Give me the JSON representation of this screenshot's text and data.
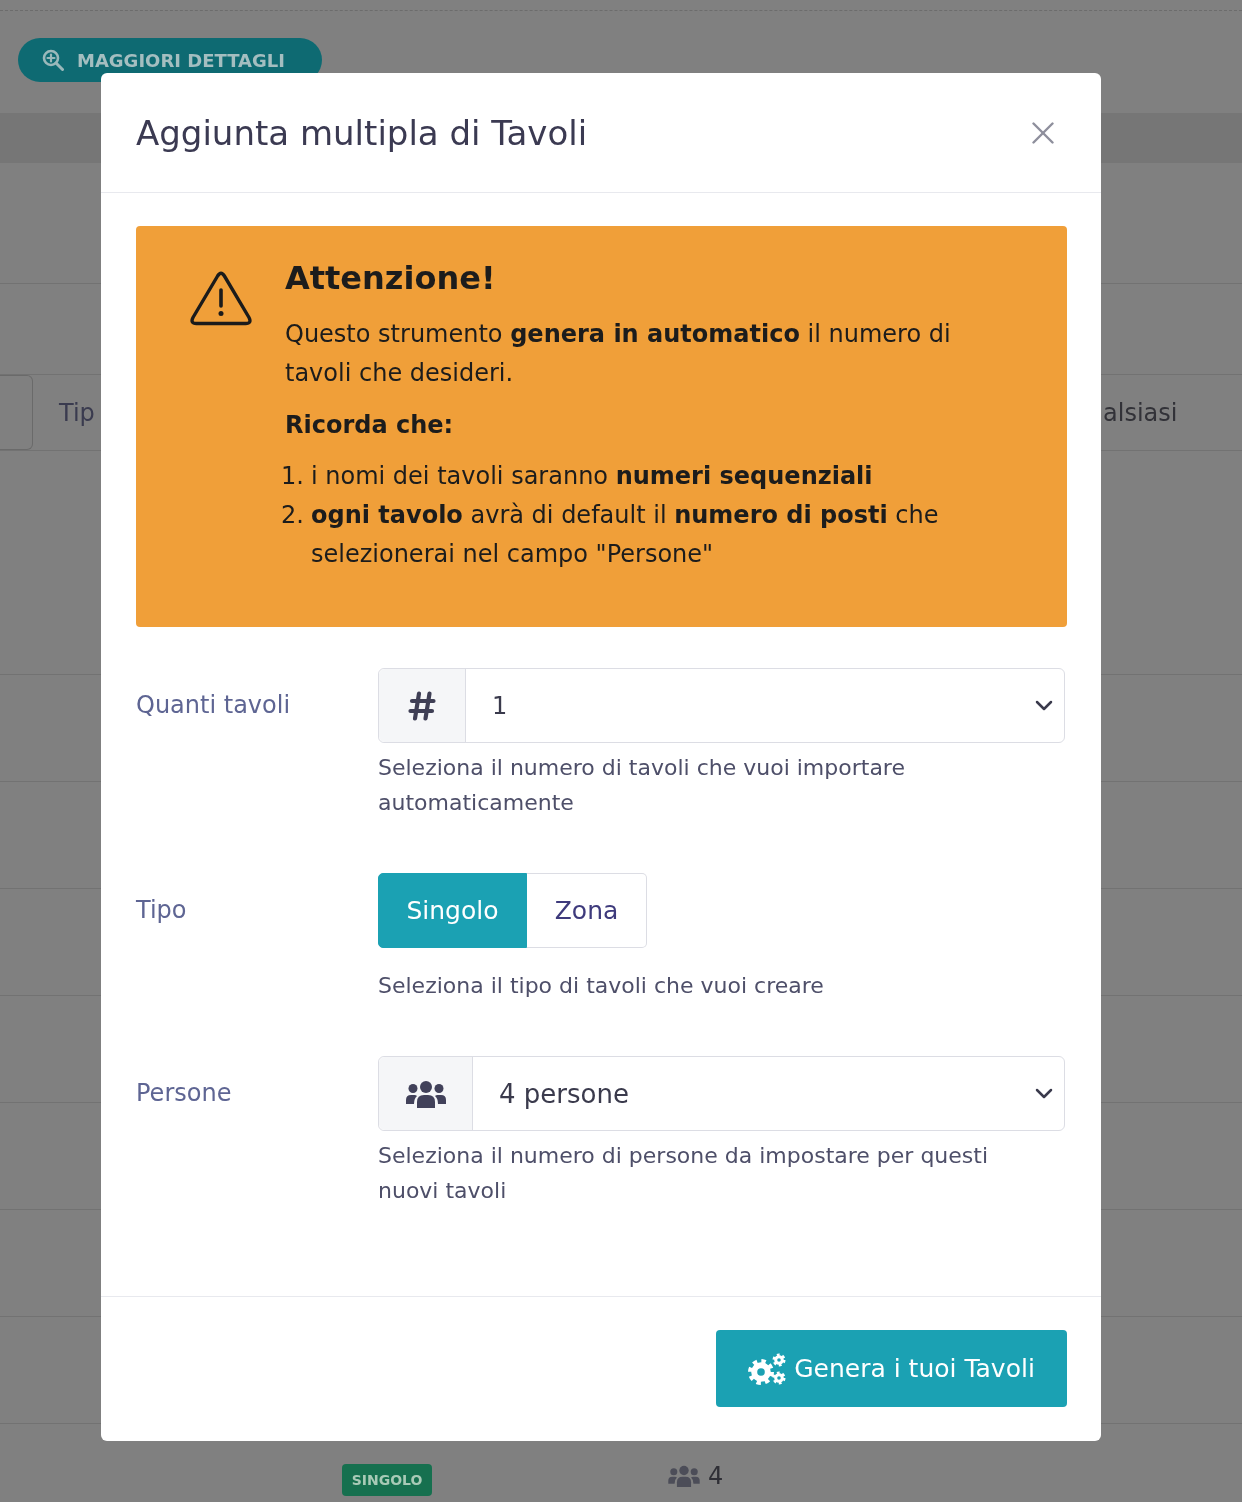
{
  "page": {
    "details_button": {
      "label": "MAGGIORI DETTAGLI"
    },
    "filter_row": {
      "label": "Tip",
      "text": "alsiasi"
    },
    "table_row": {
      "type_badge": "SINGOLO",
      "people_count": "4"
    }
  },
  "modal": {
    "title": "Aggiunta multipla di Tavoli",
    "alert": {
      "heading": "Attenzione!",
      "text": "Questo strumento **genera in automatico** il numero di tavoli che desideri.",
      "subheading": "Ricorda che:",
      "items": [
        {
          "number": "1.",
          "text": "i nomi dei tavoli saranno **numeri sequenziali**"
        },
        {
          "number": "2.",
          "text": "**ogni tavolo** avrà di default il **numero di posti** che selezionerai nel campo \"Persone\""
        }
      ]
    },
    "count_field": {
      "label": "Quanti tavoli",
      "value": "1",
      "help": "Seleziona il numero di tavoli che vuoi importare automaticamente"
    },
    "type_field": {
      "label": "Tipo",
      "options": [
        {
          "label": "Singolo",
          "selected": true
        },
        {
          "label": "Zona",
          "selected": false
        }
      ],
      "help": "Seleziona il tipo di tavoli che vuoi creare"
    },
    "people_field": {
      "label": "Persone",
      "value": "4 persone",
      "help": "Seleziona il numero di persone da impostare per questi nuovi tavoli"
    },
    "submit_button": {
      "label": "Genera i tuoi Tavoli"
    }
  }
}
